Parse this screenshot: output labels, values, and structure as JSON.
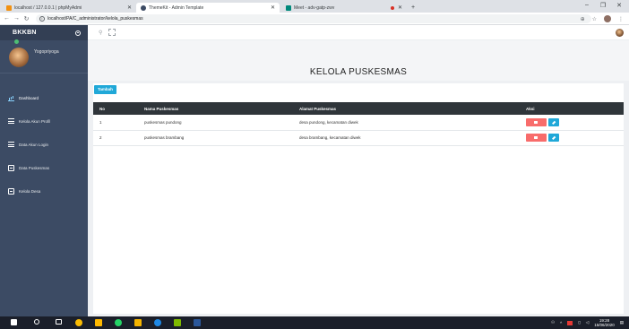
{
  "browser": {
    "tabs": [
      {
        "title": "localhost / 127.0.0.1 | phpMyAdmi",
        "active": false,
        "icon": "phpmyadmin-icon"
      },
      {
        "title": "ThemeKit - Admin Template",
        "active": true,
        "icon": "themekit-icon"
      },
      {
        "title": "Meet - adv-gatp-zwv",
        "active": false,
        "icon": "meet-icon"
      },
      {
        "title": "",
        "active": false,
        "icon": "recording-icon"
      }
    ],
    "new_tab": "+",
    "url": "localhost/PA/C_administrator/kelola_puskesmas"
  },
  "sidebar": {
    "brand": "BKKBN",
    "username": "Yogopriyoga",
    "items": [
      {
        "label": "Dashboard",
        "icon": "dashboard-icon"
      },
      {
        "label": "Kelola Akun Profil",
        "icon": "list-icon"
      },
      {
        "label": "Data Akun Login",
        "icon": "list-icon"
      },
      {
        "label": "Data Puskesmas",
        "icon": "box-icon"
      },
      {
        "label": "Kelola Desa",
        "icon": "box-icon"
      }
    ]
  },
  "main": {
    "title": "KELOLA PUSKESMAS",
    "add_button": "Tambah",
    "table": {
      "columns": [
        "No",
        "Nama Puskesmas",
        "Alamat Puskesmas",
        "Aksi"
      ],
      "rows": [
        [
          "1",
          "puskesmas pundong",
          "desa pundong, kecamatan diwek"
        ],
        [
          "2",
          "puskesmas brambang",
          "desa brambang, kecamatan diwek"
        ]
      ]
    }
  },
  "taskbar": {
    "time": "19:28",
    "date": "15/06/2020"
  },
  "colors": {
    "sidebar": "#3c4b64",
    "primary": "#20a8d8",
    "danger": "#f86c6b",
    "table_header": "#2f353a"
  }
}
